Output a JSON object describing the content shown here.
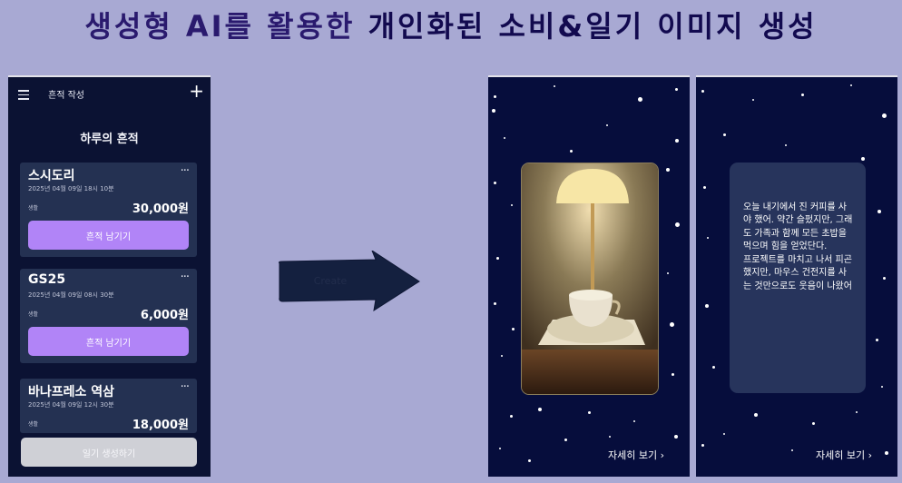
{
  "headline": {
    "part1": "생성형 AI를 활용한 ",
    "part2": "개인화된 소비&일기 이미지 생성"
  },
  "left_phone": {
    "topbar_title": "흔적 작성",
    "section_title": "하루의 흔적",
    "cards": [
      {
        "name": "스시도리",
        "date": "2025년 04월 09일 18시 10분",
        "category": "생활",
        "amount": "30,000원",
        "button": "흔적 남기기"
      },
      {
        "name": "GS25",
        "date": "2025년 04월 09일 08시 30분",
        "category": "생활",
        "amount": "6,000원",
        "button": "흔적 남기기"
      },
      {
        "name": "바나프레소 역삼",
        "date": "2025년 04월 09일 12시 30분",
        "category": "생활",
        "amount": "18,000원"
      }
    ],
    "more_icon": "···",
    "generate_button": "일기 생성하기"
  },
  "arrow_text": "Create",
  "right_phones": {
    "diary_text": "오늘 내기에서 진 커피를 사야 했어. 약간 슬펐지만, 그래도 가족과 함께 모든 초밥을 먹으며 힘을 얻었단다.\n프로젝트를 마치고 나서 피곤했지만, 마우스 건전지를 사는 것만으로도 웃음이 나왔어",
    "detail_link_1": "자세히 보기  ›",
    "detail_link_2": "자세히 보기  ›"
  }
}
